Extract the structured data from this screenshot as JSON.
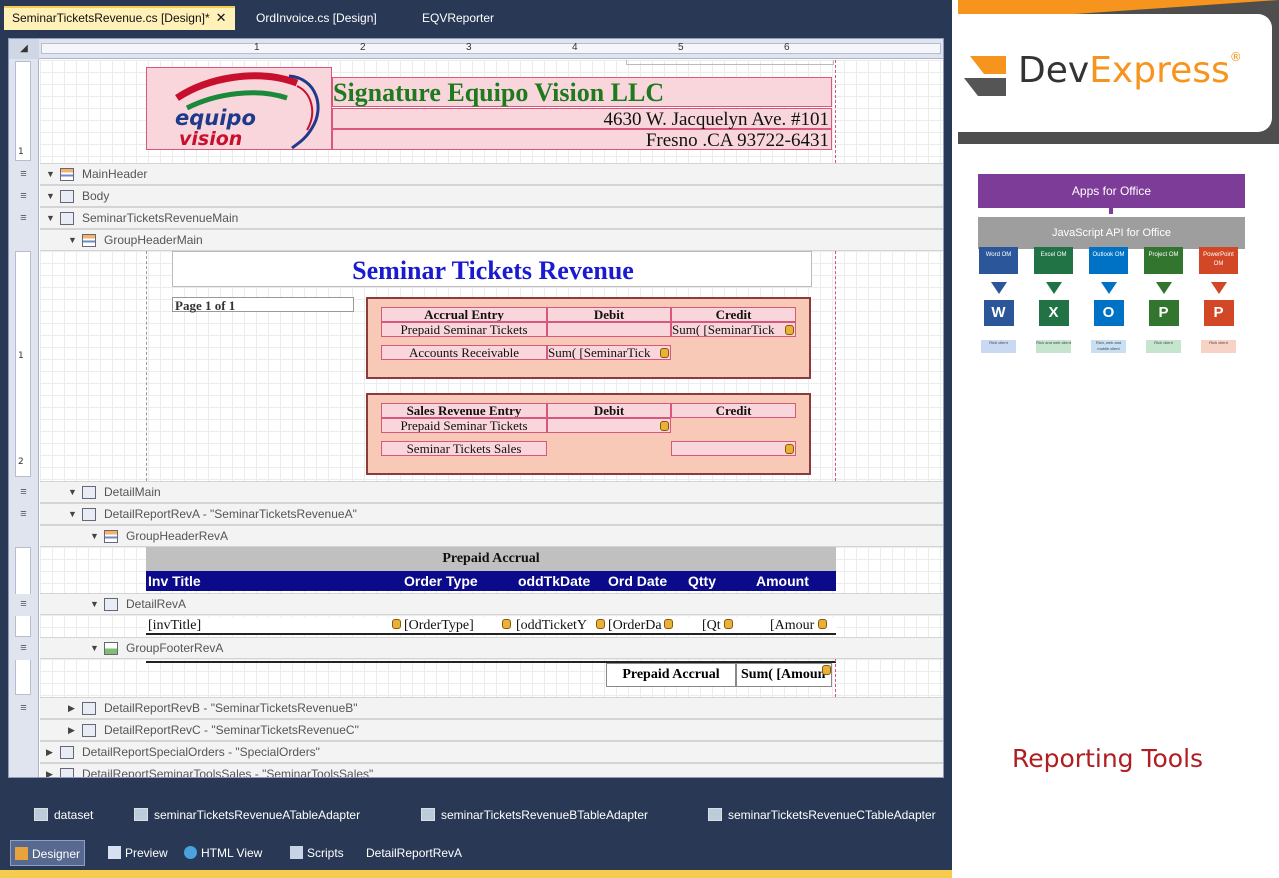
{
  "tabs": [
    {
      "label": "SeminarTicketsRevenue.cs [Design]*",
      "active": true
    },
    {
      "label": "OrdInvoice.cs [Design]",
      "active": false
    },
    {
      "label": "EQVReporter",
      "active": false
    }
  ],
  "tab_close_glyph": "✕",
  "ruler": {
    "numbers": [
      "1",
      "2",
      "3",
      "4",
      "5",
      "6"
    ],
    "vertical": [
      "1",
      "1",
      "2"
    ]
  },
  "company": {
    "logo_line1": "equipo",
    "logo_line2": "vision",
    "name": "Signature Equipo Vision LLC",
    "address": "4630 W. Jacquelyn Ave. #101",
    "city": "Fresno .CA 93722-6431"
  },
  "bands": {
    "main_header": "MainHeader",
    "body": "Body",
    "main": "SeminarTicketsRevenueMain",
    "group_header_main": "GroupHeaderMain",
    "detail_main": "DetailMain",
    "detail_report_a": "DetailReportRevA - \"SeminarTicketsRevenueA\"",
    "group_header_a": "GroupHeaderRevA",
    "detail_a": "DetailRevA",
    "group_footer_a": "GroupFooterRevA",
    "detail_report_b": "DetailReportRevB - \"SeminarTicketsRevenueB\"",
    "detail_report_c": "DetailReportRevC - \"SeminarTicketsRevenueC\"",
    "special_orders": "DetailReportSpecialOrders - \"SpecialOrders\"",
    "tools_sales": "DetailReportSeminarToolsSales - \"SeminarToolsSales\""
  },
  "report": {
    "title": "Seminar Tickets Revenue",
    "page": "Page 1 of 1",
    "accrual": {
      "headers": [
        "Accrual Entry",
        "Debit",
        "Credit"
      ],
      "row1_label": "Prepaid Seminar Tickets",
      "row1_credit": "Sum( [SeminarTick",
      "row2_label": "Accounts Receivable",
      "row2_debit": "Sum( [SeminarTick"
    },
    "sales": {
      "headers": [
        "Sales Revenue Entry",
        "Debit",
        "Credit"
      ],
      "row1_label": "Prepaid Seminar Tickets",
      "row2_label": "Seminar Tickets Sales"
    },
    "prepaid_title": "Prepaid Accrual",
    "columns": [
      "Inv Title",
      "Order Type",
      "oddTkDate",
      "Ord Date",
      "Qtty",
      "Amount"
    ],
    "detail_fields": [
      "[invTitle]",
      "[OrderType]",
      "[oddTicketY",
      "[OrderDa",
      "[Qt",
      "[Amour"
    ],
    "footer_label": "Prepaid Accrual",
    "footer_sum": "Sum( [Amoun"
  },
  "tray": [
    "dataset",
    "seminarTicketsRevenueATableAdapter",
    "seminarTicketsRevenueBTableAdapter",
    "seminarTicketsRevenueCTableAdapter"
  ],
  "bottom_tabs": [
    "Designer",
    "Preview",
    "HTML View",
    "Scripts",
    "DetailReportRevA"
  ],
  "devexpress": {
    "dev": "Dev",
    "express": "Express",
    "reg": "®"
  },
  "arch": {
    "top": "Apps for Office",
    "api": "JavaScript API for Office",
    "columns": [
      {
        "head": "Word OM",
        "letter": "W",
        "color": "#2b579a",
        "foot_bg": "#c9d9f2",
        "foot": "Rich client"
      },
      {
        "head": "Excel OM",
        "letter": "X",
        "color": "#217346",
        "foot_bg": "#c6e5cf",
        "foot": "Rich and web client"
      },
      {
        "head": "Outlook OM",
        "letter": "O",
        "color": "#0072c6",
        "foot_bg": "#c9dff2",
        "foot": "Rich, web and mobile client"
      },
      {
        "head": "Project OM",
        "letter": "P",
        "color": "#31752f",
        "foot_bg": "#c6e5cf",
        "foot": "Rich client"
      },
      {
        "head": "PowerPoint OM",
        "letter": "P",
        "color": "#d24726",
        "foot_bg": "#f7d3c6",
        "foot": "Rich client"
      }
    ]
  },
  "caption": "Reporting Tools"
}
